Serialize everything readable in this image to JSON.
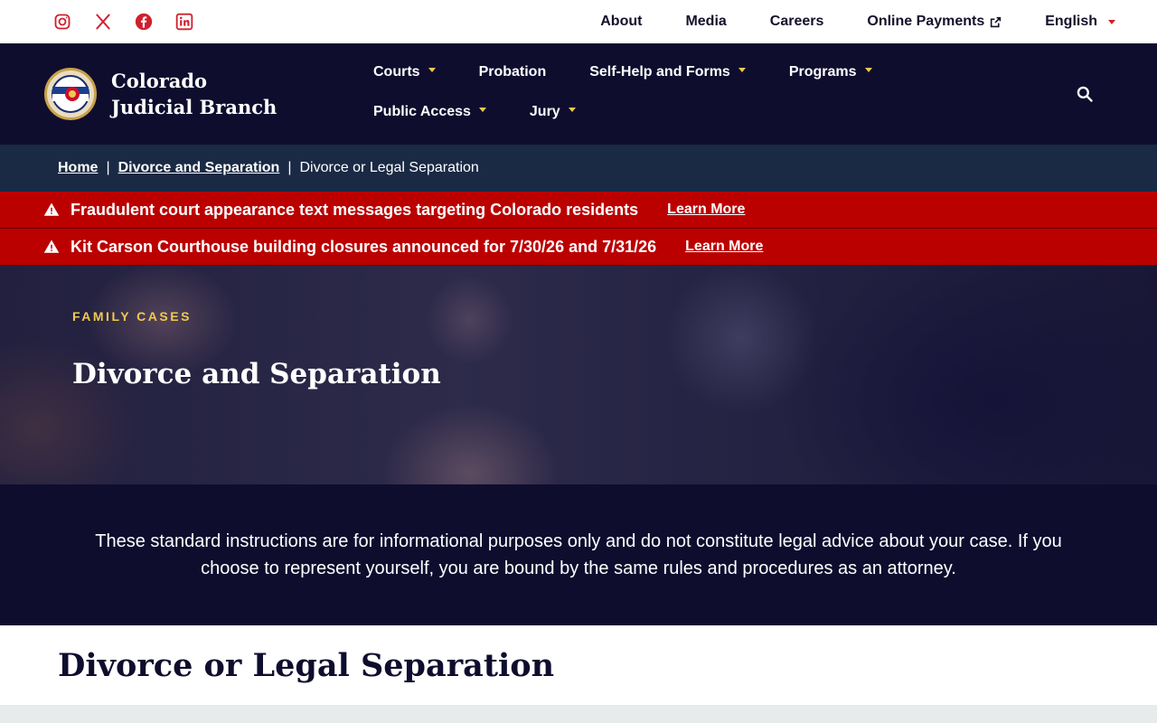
{
  "social": {
    "icons": [
      "instagram-icon",
      "x-twitter-icon",
      "facebook-icon",
      "linkedin-icon"
    ],
    "color": "#d0202e"
  },
  "utility": {
    "about": "About",
    "media": "Media",
    "careers": "Careers",
    "online_payments": "Online Payments",
    "language": "English"
  },
  "brand": {
    "name": "Colorado Judicial Branch"
  },
  "nav": {
    "courts": "Courts",
    "probation": "Probation",
    "self_help": "Self-Help and Forms",
    "programs": "Programs",
    "public_access": "Public Access",
    "jury": "Jury"
  },
  "breadcrumb": {
    "home": "Home",
    "parent": "Divorce and Separation",
    "current": "Divorce or Legal Separation"
  },
  "alerts": [
    {
      "text": "Fraudulent court appearance text messages targeting Colorado residents",
      "link": "Learn More"
    },
    {
      "text": "Kit Carson Courthouse building closures announced for 7/30/26 and 7/31/26",
      "link": "Learn More"
    }
  ],
  "hero": {
    "eyebrow": "FAMILY CASES",
    "title": "Divorce and Separation"
  },
  "disclaimer": {
    "text": "These standard instructions are for informational purposes only and do not constitute legal advice about your case. If you choose to represent yourself, you are bound by the same rules and procedures as an attorney."
  },
  "page": {
    "title": "Divorce or Legal Separation"
  },
  "colors": {
    "navy": "#0f0d2e",
    "alert_red": "#bb0000",
    "accent_gold": "#f2c94c",
    "breadcrumb_bg": "#1a2a44"
  }
}
